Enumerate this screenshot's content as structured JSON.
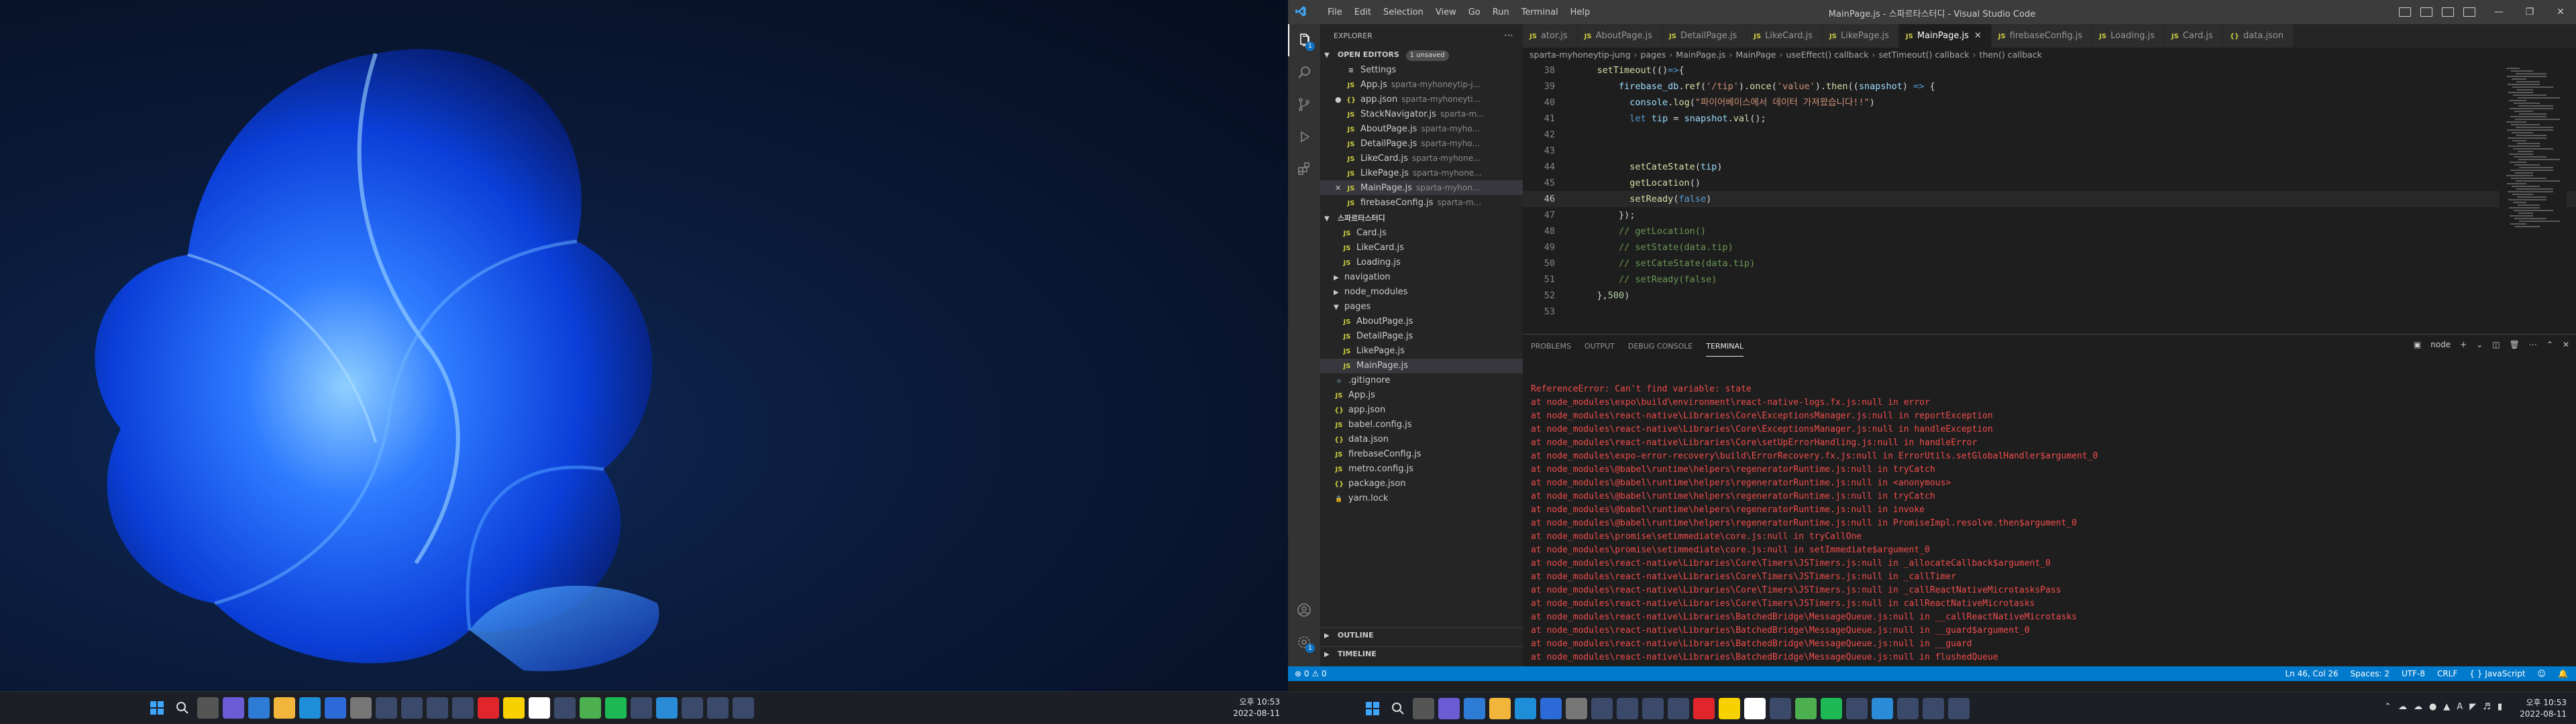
{
  "left_monitor": {
    "wallpaper": "windows-11-bloom",
    "clock": {
      "time": "오후 10:53",
      "date": "2022-08-11"
    },
    "taskbar_icons": [
      "windows-start-icon",
      "search-icon",
      "task-view-icon",
      "chat-icon",
      "widgets-icon",
      "explorer-icon",
      "edge-icon",
      "store-icon",
      "settings-icon",
      "app-icon",
      "app-icon",
      "app-icon",
      "app-icon",
      "youtube-icon",
      "kakao-icon",
      "notion-icon",
      "app-icon",
      "chrome-icon",
      "spotify-icon",
      "app-icon",
      "vscode-icon",
      "app-icon",
      "app-icon",
      "app-icon"
    ]
  },
  "vscode": {
    "menu": [
      "File",
      "Edit",
      "Selection",
      "View",
      "Go",
      "Run",
      "Terminal",
      "Help"
    ],
    "window_title": "MainPage.js - 스파르타스터디 - Visual Studio Code",
    "explorer": {
      "header": "EXPLORER",
      "open_editors_label": "OPEN EDITORS",
      "unsaved_label": "1 unsaved",
      "open_editors": [
        {
          "icon": "settings",
          "name": "Settings",
          "desc": "",
          "state": ""
        },
        {
          "icon": "js",
          "name": "App.js",
          "desc": "sparta-myhoneytip-j...",
          "state": ""
        },
        {
          "icon": "json",
          "name": "app.json",
          "desc": "sparta-myhoneyti...",
          "state": "dirty"
        },
        {
          "icon": "js",
          "name": "StackNavigator.js",
          "desc": "sparta-m...",
          "state": ""
        },
        {
          "icon": "js",
          "name": "AboutPage.js",
          "desc": "sparta-myho...",
          "state": ""
        },
        {
          "icon": "js",
          "name": "DetailPage.js",
          "desc": "sparta-myho...",
          "state": ""
        },
        {
          "icon": "js",
          "name": "LikeCard.js",
          "desc": "sparta-myhone...",
          "state": ""
        },
        {
          "icon": "js",
          "name": "LikePage.js",
          "desc": "sparta-myhone...",
          "state": ""
        },
        {
          "icon": "js",
          "name": "MainPage.js",
          "desc": "sparta-myhon...",
          "state": "active"
        },
        {
          "icon": "js",
          "name": "firebaseConfig.js",
          "desc": "sparta-m...",
          "state": ""
        }
      ],
      "workspace_label": "스파르타스터디",
      "tree": [
        {
          "kind": "file",
          "icon": "js",
          "name": "Card.js",
          "indent": 2,
          "sel": false
        },
        {
          "kind": "file",
          "icon": "js",
          "name": "LikeCard.js",
          "indent": 2,
          "sel": false
        },
        {
          "kind": "file",
          "icon": "js",
          "name": "Loading.js",
          "indent": 2,
          "sel": false
        },
        {
          "kind": "folder",
          "open": false,
          "name": "navigation",
          "indent": 1,
          "sel": false
        },
        {
          "kind": "folder",
          "open": false,
          "name": "node_modules",
          "indent": 1,
          "sel": false
        },
        {
          "kind": "folder",
          "open": true,
          "name": "pages",
          "indent": 1,
          "sel": false
        },
        {
          "kind": "file",
          "icon": "js",
          "name": "AboutPage.js",
          "indent": 2,
          "sel": false
        },
        {
          "kind": "file",
          "icon": "js",
          "name": "DetailPage.js",
          "indent": 2,
          "sel": false
        },
        {
          "kind": "file",
          "icon": "js",
          "name": "LikePage.js",
          "indent": 2,
          "sel": false
        },
        {
          "kind": "file",
          "icon": "js",
          "name": "MainPage.js",
          "indent": 2,
          "sel": true
        },
        {
          "kind": "file",
          "icon": "git",
          "name": ".gitignore",
          "indent": 1,
          "sel": false
        },
        {
          "kind": "file",
          "icon": "js",
          "name": "App.js",
          "indent": 1,
          "sel": false
        },
        {
          "kind": "file",
          "icon": "json",
          "name": "app.json",
          "indent": 1,
          "sel": false
        },
        {
          "kind": "file",
          "icon": "js",
          "name": "babel.config.js",
          "indent": 1,
          "sel": false
        },
        {
          "kind": "file",
          "icon": "json",
          "name": "data.json",
          "indent": 1,
          "sel": false
        },
        {
          "kind": "file",
          "icon": "js",
          "name": "firebaseConfig.js",
          "indent": 1,
          "sel": false
        },
        {
          "kind": "file",
          "icon": "js",
          "name": "metro.config.js",
          "indent": 1,
          "sel": false
        },
        {
          "kind": "file",
          "icon": "json",
          "name": "package.json",
          "indent": 1,
          "sel": false
        },
        {
          "kind": "file",
          "icon": "lock",
          "name": "yarn.lock",
          "indent": 1,
          "sel": false
        }
      ],
      "outline_label": "OUTLINE",
      "timeline_label": "TIMELINE"
    },
    "tabs": [
      {
        "name": "ator.js",
        "active": false
      },
      {
        "name": "AboutPage.js",
        "active": false
      },
      {
        "name": "DetailPage.js",
        "active": false
      },
      {
        "name": "LikeCard.js",
        "active": false
      },
      {
        "name": "LikePage.js",
        "active": false
      },
      {
        "name": "MainPage.js",
        "active": true
      },
      {
        "name": "firebaseConfig.js",
        "active": false
      },
      {
        "name": "Loading.js",
        "active": false
      },
      {
        "name": "Card.js",
        "active": false
      },
      {
        "name": "data.json",
        "active": false
      }
    ],
    "breadcrumbs": [
      "sparta-myhoneytip-jung",
      "pages",
      "MainPage.js",
      "MainPage",
      "useEffect() callback",
      "setTimeout() callback",
      "then() callback"
    ],
    "code_lines": [
      {
        "n": "38",
        "t": "    setTimeout(()=>{"
      },
      {
        "n": "39",
        "t": "        firebase_db.ref('/tip').once('value').then((snapshot) => {"
      },
      {
        "n": "40",
        "t": "          console.log(\"파이어베이스에서 데이터 가져왔습니다!!\")"
      },
      {
        "n": "41",
        "t": "          let tip = snapshot.val();"
      },
      {
        "n": "42",
        "t": ""
      },
      {
        "n": "43",
        "t": ""
      },
      {
        "n": "44",
        "t": "          setCateState(tip)"
      },
      {
        "n": "45",
        "t": "          getLocation()"
      },
      {
        "n": "46",
        "t": "          setReady(false)"
      },
      {
        "n": "47",
        "t": "        });"
      },
      {
        "n": "48",
        "t": "        // getLocation()"
      },
      {
        "n": "49",
        "t": "        // setState(data.tip)"
      },
      {
        "n": "50",
        "t": "        // setCateState(data.tip)"
      },
      {
        "n": "51",
        "t": "        // setReady(false)"
      },
      {
        "n": "52",
        "t": "    },500)"
      },
      {
        "n": "53",
        "t": ""
      }
    ],
    "current_line": "46",
    "panel": {
      "tabs": [
        "PROBLEMS",
        "OUTPUT",
        "DEBUG CONSOLE",
        "TERMINAL"
      ],
      "active_tab": "TERMINAL",
      "shell": "node",
      "terminal_lines": [
        "ReferenceError: Can't find variable: state",
        "at node_modules\\expo\\build\\environment\\react-native-logs.fx.js:null in error",
        "at node_modules\\react-native\\Libraries\\Core\\ExceptionsManager.js:null in reportException",
        "at node_modules\\react-native\\Libraries\\Core\\ExceptionsManager.js:null in handleException",
        "at node_modules\\react-native\\Libraries\\Core\\setUpErrorHandling.js:null in handleError",
        "at node_modules\\expo-error-recovery\\build\\ErrorRecovery.fx.js:null in ErrorUtils.setGlobalHandler$argument_0",
        "at node_modules\\@babel\\runtime\\helpers\\regeneratorRuntime.js:null in tryCatch",
        "at node_modules\\@babel\\runtime\\helpers\\regeneratorRuntime.js:null in <anonymous>",
        "at node_modules\\@babel\\runtime\\helpers\\regeneratorRuntime.js:null in tryCatch",
        "at node_modules\\@babel\\runtime\\helpers\\regeneratorRuntime.js:null in invoke",
        "at node_modules\\@babel\\runtime\\helpers\\regeneratorRuntime.js:null in PromiseImpl.resolve.then$argument_0",
        "at node_modules\\promise\\setimmediate\\core.js:null in tryCallOne",
        "at node_modules\\promise\\setimmediate\\core.js:null in setImmediate$argument_0",
        "at node_modules\\react-native\\Libraries\\Core\\Timers\\JSTimers.js:null in _allocateCallback$argument_0",
        "at node_modules\\react-native\\Libraries\\Core\\Timers\\JSTimers.js:null in _callTimer",
        "at node_modules\\react-native\\Libraries\\Core\\Timers\\JSTimers.js:null in _callReactNativeMicrotasksPass",
        "at node_modules\\react-native\\Libraries\\Core\\Timers\\JSTimers.js:null in callReactNativeMicrotasks",
        "at node_modules\\react-native\\Libraries\\BatchedBridge\\MessageQueue.js:null in __callReactNativeMicrotasks",
        "at node_modules\\react-native\\Libraries\\BatchedBridge\\MessageQueue.js:null in __guard$argument_0",
        "at node_modules\\react-native\\Libraries\\BatchedBridge\\MessageQueue.js:null in __guard",
        "at node_modules\\react-native\\Libraries\\BatchedBridge\\MessageQueue.js:null in flushedQueue"
      ]
    },
    "status": {
      "errors": "0",
      "warnings": "0",
      "position": "Ln 46, Col 26",
      "spaces": "Spaces: 2",
      "encoding": "UTF-8",
      "eol": "CRLF",
      "language": "JavaScript"
    }
  },
  "right_monitor": {
    "clock": {
      "time": "오후 10:53",
      "date": "2022-08-11"
    },
    "taskbar_icons": [
      "windows-start-icon",
      "search-icon",
      "task-view-icon",
      "chat-icon",
      "widgets-icon",
      "explorer-icon",
      "edge-icon",
      "store-icon",
      "settings-icon",
      "app-icon",
      "app-icon",
      "app-icon",
      "app-icon",
      "youtube-icon",
      "kakao-icon",
      "notion-icon",
      "app-icon",
      "chrome-icon",
      "spotify-icon",
      "app-icon",
      "vscode-icon",
      "app-icon",
      "app-icon",
      "app-icon"
    ]
  }
}
